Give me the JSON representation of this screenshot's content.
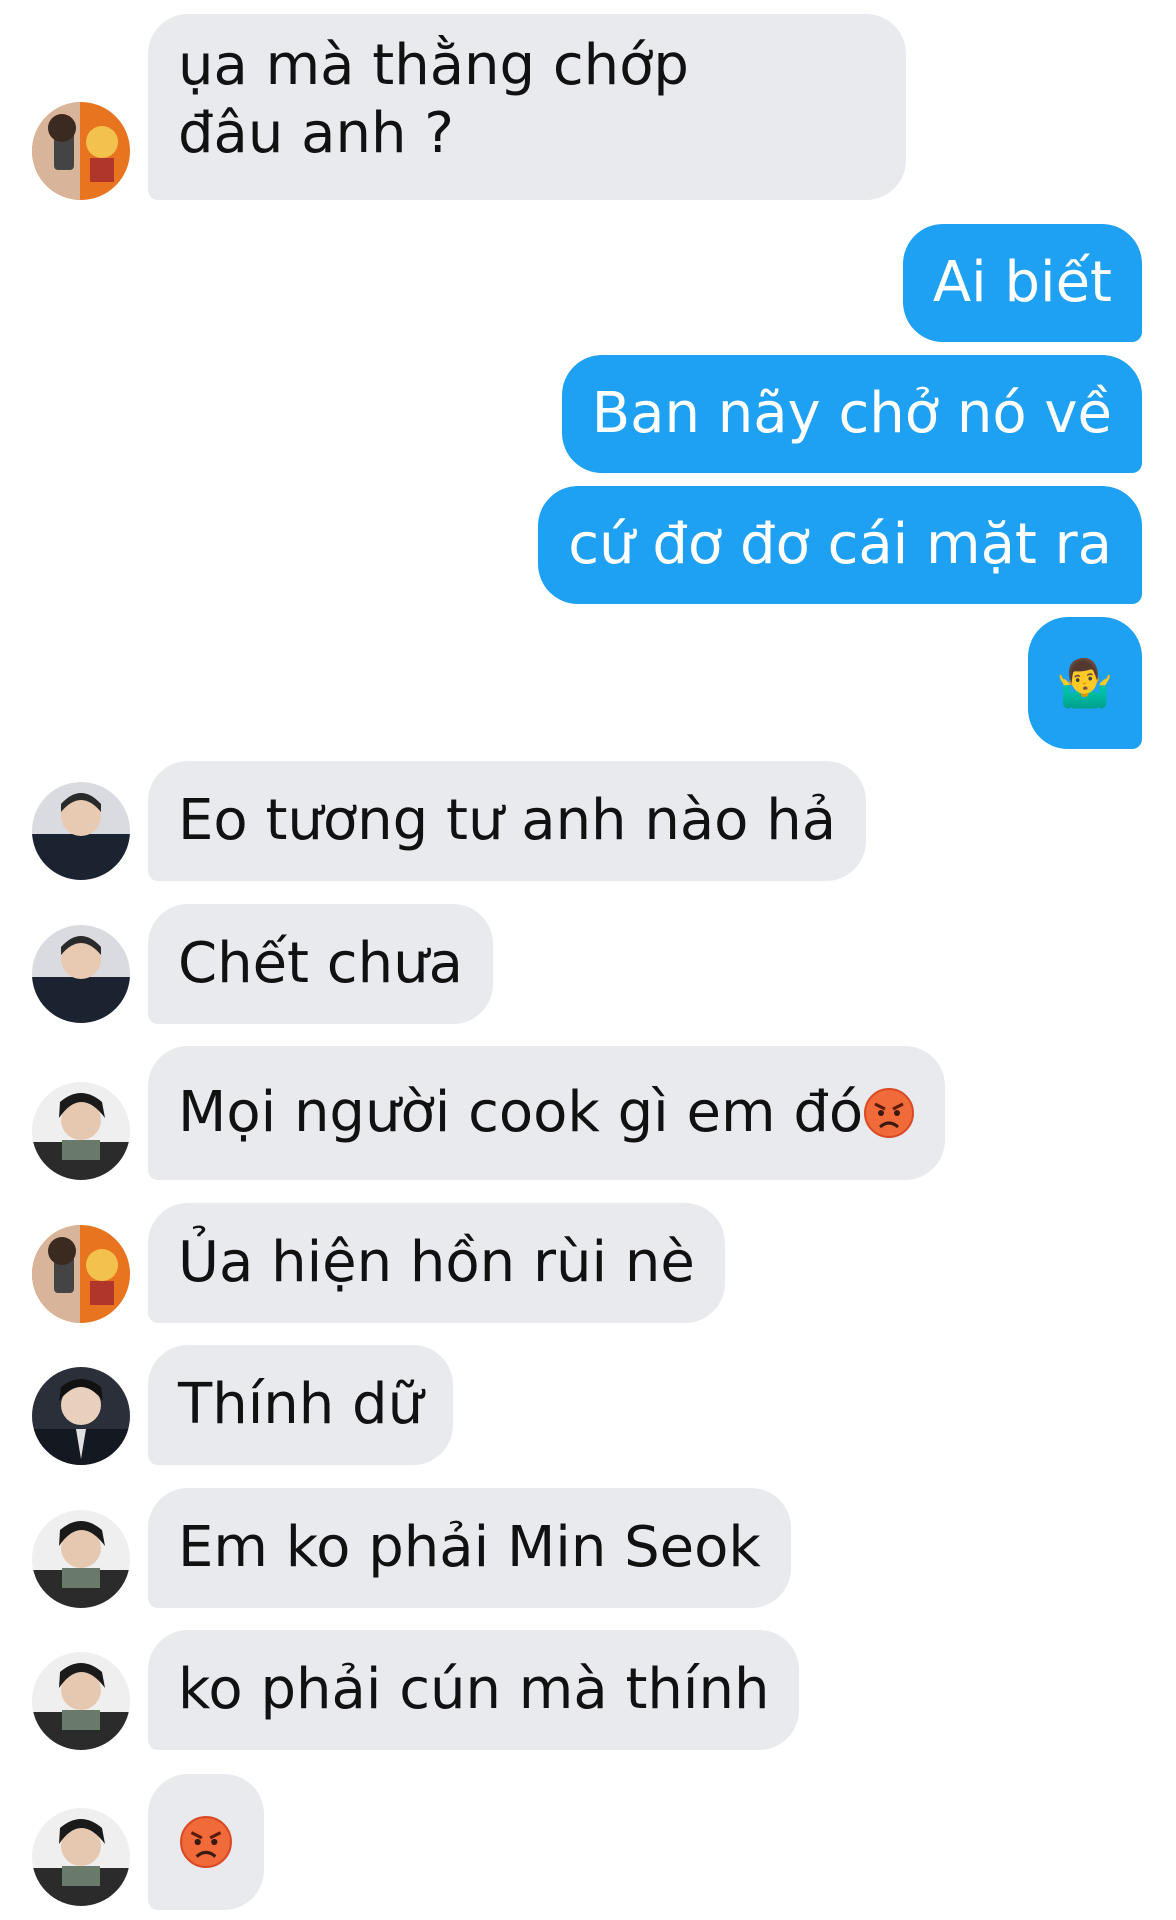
{
  "conversation": {
    "messages": [
      {
        "text": "ụa mà thằng chớp đâu anh ?"
      },
      {
        "text": "Ai biết"
      },
      {
        "text": "Ban nãy chở nó về"
      },
      {
        "text": "cứ đơ đơ cái mặt ra"
      },
      {
        "text": "🤷‍♂️"
      },
      {
        "text": "Eo tương tư anh nào hả"
      },
      {
        "text": "Chết chưa"
      },
      {
        "text": "Mọi người cook gì em đó"
      },
      {
        "text": "Ủa hiện hồn rùi nè"
      },
      {
        "text": "Thính dữ"
      },
      {
        "text": "Em ko phải Min Seok"
      },
      {
        "text": "ko phải cún mà thính"
      },
      {
        "text": "😡"
      }
    ]
  },
  "colors": {
    "incoming_bubble": "#e9eaee",
    "outgoing_bubble": "#1ea1f2"
  }
}
